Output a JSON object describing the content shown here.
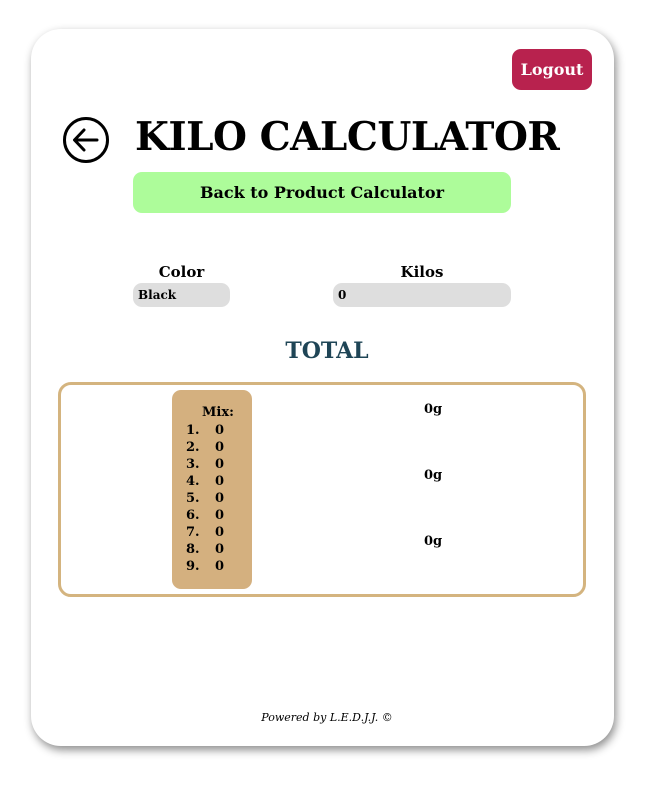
{
  "header": {
    "logout_label": "Logout",
    "title": "KILO CALCULATOR",
    "back_to_product_label": "Back to Product Calculator"
  },
  "form": {
    "color_label": "Color",
    "color_value": "Black",
    "kilos_label": "Kilos",
    "kilos_value": "0"
  },
  "total": {
    "heading": "TOTAL",
    "mix_title": "Mix:",
    "mix_items": [
      {
        "num": "1.",
        "value": "0"
      },
      {
        "num": "2.",
        "value": "0"
      },
      {
        "num": "3.",
        "value": "0"
      },
      {
        "num": "4.",
        "value": "0"
      },
      {
        "num": "5.",
        "value": "0"
      },
      {
        "num": "6.",
        "value": "0"
      },
      {
        "num": "7.",
        "value": "0"
      },
      {
        "num": "8.",
        "value": "0"
      },
      {
        "num": "9.",
        "value": "0"
      }
    ],
    "grams": [
      "0g",
      "0g",
      "0g"
    ]
  },
  "footer": {
    "text": "Powered by L.E.D.J.J. ©"
  },
  "colors": {
    "logout_bg": "#b8224e",
    "back_button_bg": "#adfc9a",
    "total_heading": "#1f4556",
    "mix_bg": "#d4b07f",
    "box_border": "#d4b47f",
    "field_bg": "#dedede"
  },
  "icons": {
    "back": "arrow-left-circle-icon"
  }
}
